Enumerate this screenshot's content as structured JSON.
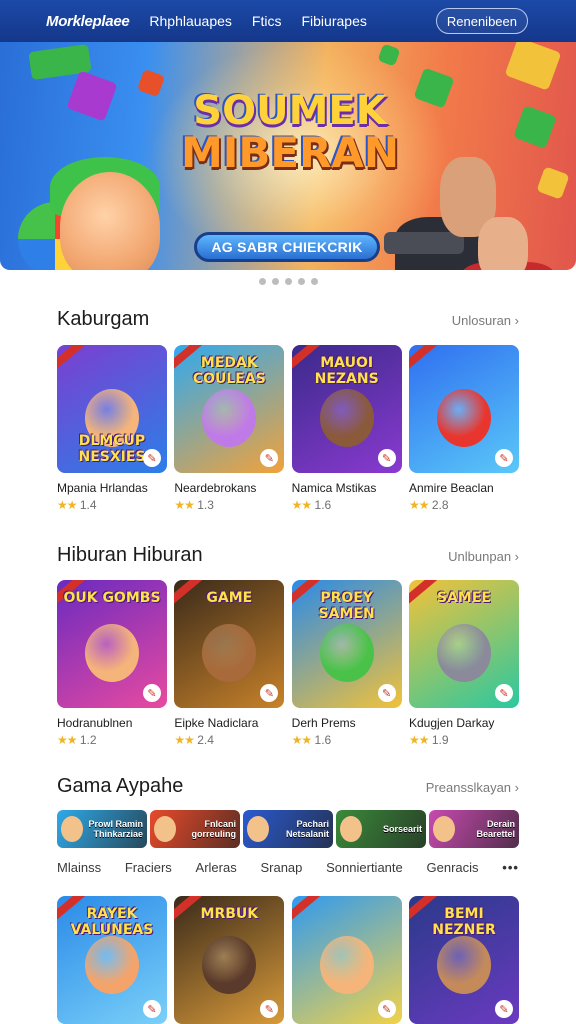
{
  "nav": {
    "brand": "Morkleplaee",
    "links": [
      "Rhphlauapes",
      "Ftics",
      "Fibiurapes"
    ],
    "button": "Renenibeen"
  },
  "hero": {
    "title_line1": "SOUMEK",
    "title_line2": "MIBERAN",
    "cta": "AG SABR CHIEKCRIK",
    "slides": 5
  },
  "sections": [
    {
      "title": "Kaburgam",
      "link": "Unlosuran",
      "items": [
        {
          "name": "Mpania Hrlandas",
          "rating": "1.4",
          "art": "DLMCUP NESXIES",
          "bg": [
            "#7b3fd0",
            "#2c7fe8"
          ],
          "face": "#f4b47a"
        },
        {
          "name": "Neardebrokans",
          "rating": "1.3",
          "art": "MEDAK COULEAS",
          "bg": [
            "#2fa9f0",
            "#f2a23a"
          ],
          "face": "#c07ae8"
        },
        {
          "name": "Namica Mstikas",
          "rating": "1.6",
          "art": "MAUOI NEZANS",
          "bg": [
            "#3a2a8a",
            "#8a3ad0"
          ],
          "face": "#8a5a3a"
        },
        {
          "name": "Anmire Beaclan",
          "rating": "2.8",
          "art": "",
          "bg": [
            "#2f6ff0",
            "#5ac8f8"
          ],
          "face": "#e8362e"
        }
      ]
    },
    {
      "title": "Hiburan Hiburan",
      "link": "Unlbunpan",
      "items": [
        {
          "name": "Hodranublnen",
          "rating": "1.2",
          "art": "OUK GOMBS",
          "bg": [
            "#6a2ac0",
            "#e84aa0"
          ],
          "face": "#f4b47a"
        },
        {
          "name": "Eipke Nadiclara",
          "rating": "2.4",
          "art": "GAME",
          "bg": [
            "#3a2a1a",
            "#c8822a"
          ],
          "face": "#a86a3a"
        },
        {
          "name": "Derh Prems",
          "rating": "1.6",
          "art": "PROEY SAMEN",
          "bg": [
            "#2a8ae8",
            "#f2c23a"
          ],
          "face": "#4ac24a"
        },
        {
          "name": "Kdugjen Darkay",
          "rating": "1.9",
          "art": "SAMEE",
          "bg": [
            "#f2c23a",
            "#2ac8a0"
          ],
          "face": "#8a8a9a"
        }
      ]
    },
    {
      "title": "Gama Aypahe",
      "link": "Preansslkayan",
      "items": [
        {
          "name": "",
          "rating": "",
          "art": "RAYEK VALUNEAS",
          "bg": [
            "#2a8ae8",
            "#7ad0f8"
          ],
          "face": "#f4a46a"
        },
        {
          "name": "",
          "rating": "",
          "art": "MRBUK",
          "bg": [
            "#3a2a1a",
            "#d89a3a"
          ],
          "face": "#5a3a2a"
        },
        {
          "name": "",
          "rating": "",
          "art": "",
          "bg": [
            "#2f9af0",
            "#f2d24a"
          ],
          "face": "#f4b47a"
        },
        {
          "name": "",
          "rating": "",
          "art": "BEMI NEZNER",
          "bg": [
            "#2a3a8a",
            "#6a3ac0"
          ],
          "face": "#c48a5a"
        }
      ]
    }
  ],
  "chips": [
    {
      "label": "Prowl Ramin Thinkarziae",
      "bg": "#2fa9e8"
    },
    {
      "label": "Fnlcani gorreuling",
      "bg": "#e84a2a"
    },
    {
      "label": "Pachari Netsalanit",
      "bg": "#2a5ad0"
    },
    {
      "label": "Sorsearit",
      "bg": "#3a8a3a"
    },
    {
      "label": "Derain Bearettel",
      "bg": "#c84ab0"
    }
  ],
  "tabs": [
    "Mlainss",
    "Fraciers",
    "Arleras",
    "Sranap",
    "Sonniertiante",
    "Genracis"
  ],
  "more": "•••"
}
